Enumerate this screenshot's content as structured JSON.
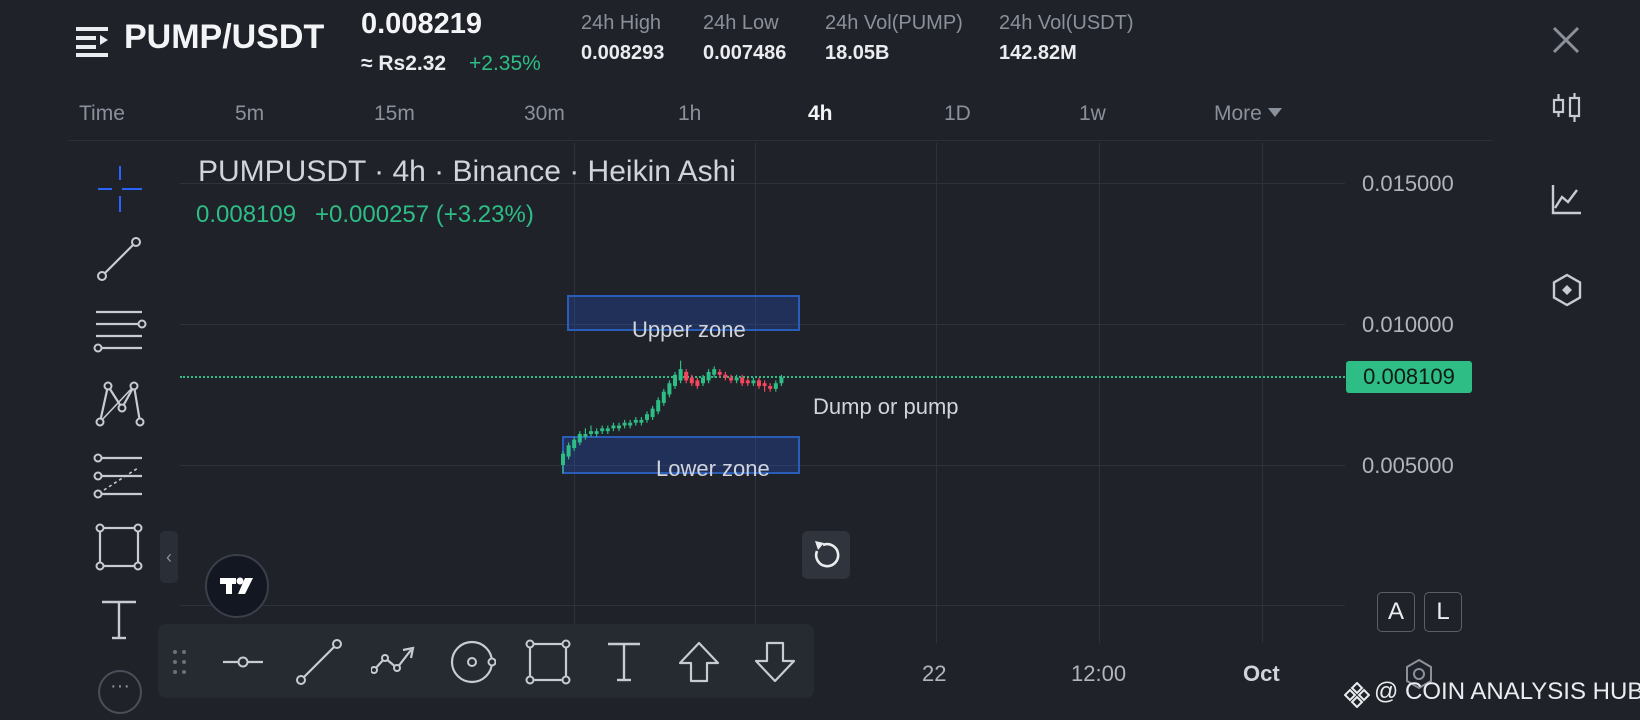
{
  "header": {
    "pair": "PUMP/USDT",
    "last_price": "0.008219",
    "fiat_price": "≈ Rs2.32",
    "change_pct": "+2.35%",
    "stats": [
      {
        "label": "24h High",
        "value": "0.008293"
      },
      {
        "label": "24h Low",
        "value": "0.007486"
      },
      {
        "label": "24h Vol(PUMP)",
        "value": "18.05B"
      },
      {
        "label": "24h Vol(USDT)",
        "value": "142.82M"
      }
    ]
  },
  "tabs": {
    "items": [
      "Time",
      "5m",
      "15m",
      "30m",
      "1h",
      "4h",
      "1D",
      "1w",
      "More"
    ],
    "active": "4h"
  },
  "chart": {
    "title": "PUMPUSDT · 4h · Binance · Heikin Ashi",
    "last": "0.008109",
    "change": "+0.000257 (+3.23%)",
    "price_ticks": [
      "0.015000",
      "0.010000",
      "0.005000"
    ],
    "last_price_tag": "0.008109",
    "x_labels": [
      "22",
      "12:00",
      "Oct"
    ],
    "annotations": {
      "upper_zone": "Upper zone",
      "lower_zone": "Lower zone",
      "note": "Dump or pump"
    }
  },
  "chart_data": {
    "type": "candlestick",
    "title": "PUMPUSDT · 4h · Binance · Heikin Ashi",
    "y_ticks": [
      0.015,
      0.01,
      0.005
    ],
    "ylim": [
      0.0,
      0.0165
    ],
    "x_ticks": [
      "22",
      "12:00",
      "Oct"
    ],
    "last_price": 0.008109,
    "zones": [
      {
        "label": "Upper zone",
        "low": 0.0099,
        "high": 0.011
      },
      {
        "label": "Lower zone",
        "low": 0.0049,
        "high": 0.0061
      }
    ],
    "candles": [
      [
        0.005,
        0.0054,
        0.0047,
        0.0055
      ],
      [
        0.0053,
        0.0057,
        0.0052,
        0.0058
      ],
      [
        0.0056,
        0.0059,
        0.0055,
        0.006
      ],
      [
        0.0058,
        0.0061,
        0.0057,
        0.0062
      ],
      [
        0.006,
        0.0061,
        0.0059,
        0.0063
      ],
      [
        0.0061,
        0.0062,
        0.006,
        0.0064
      ],
      [
        0.0061,
        0.0062,
        0.006,
        0.0063
      ],
      [
        0.0062,
        0.0063,
        0.0061,
        0.0064
      ],
      [
        0.0062,
        0.0063,
        0.0061,
        0.0064
      ],
      [
        0.0063,
        0.0064,
        0.0062,
        0.0065
      ],
      [
        0.0063,
        0.0064,
        0.0062,
        0.0065
      ],
      [
        0.0064,
        0.0065,
        0.0063,
        0.0066
      ],
      [
        0.0064,
        0.0065,
        0.0063,
        0.0066
      ],
      [
        0.0065,
        0.0066,
        0.0064,
        0.0067
      ],
      [
        0.0065,
        0.0066,
        0.0064,
        0.0067
      ],
      [
        0.0066,
        0.0068,
        0.0065,
        0.0069
      ],
      [
        0.0067,
        0.007,
        0.0066,
        0.0071
      ],
      [
        0.0069,
        0.0073,
        0.0068,
        0.0074
      ],
      [
        0.0072,
        0.0076,
        0.0071,
        0.0077
      ],
      [
        0.0075,
        0.0079,
        0.0074,
        0.008
      ],
      [
        0.0078,
        0.0082,
        0.0077,
        0.0083
      ],
      [
        0.008,
        0.0084,
        0.0079,
        0.0087
      ],
      [
        0.0083,
        0.008,
        0.0079,
        0.0084
      ],
      [
        0.0081,
        0.0079,
        0.0078,
        0.0082
      ],
      [
        0.008,
        0.0078,
        0.0077,
        0.0081
      ],
      [
        0.0079,
        0.0081,
        0.0078,
        0.0082
      ],
      [
        0.008,
        0.0083,
        0.0079,
        0.0084
      ],
      [
        0.0082,
        0.0084,
        0.0081,
        0.0085
      ],
      [
        0.0083,
        0.0082,
        0.0081,
        0.0084
      ],
      [
        0.0082,
        0.0081,
        0.008,
        0.0083
      ],
      [
        0.0081,
        0.008,
        0.0079,
        0.0082
      ],
      [
        0.008,
        0.0081,
        0.0079,
        0.0082
      ],
      [
        0.0081,
        0.0079,
        0.0078,
        0.0082
      ],
      [
        0.008,
        0.0079,
        0.0078,
        0.0081
      ],
      [
        0.0079,
        0.008,
        0.0078,
        0.0081
      ],
      [
        0.008,
        0.0078,
        0.0077,
        0.0081
      ],
      [
        0.0079,
        0.0078,
        0.0076,
        0.008
      ],
      [
        0.0078,
        0.0077,
        0.0076,
        0.0079
      ],
      [
        0.0077,
        0.0079,
        0.0076,
        0.008
      ],
      [
        0.0079,
        0.0081,
        0.0078,
        0.0082
      ]
    ],
    "candle_fields": [
      "open",
      "close",
      "low",
      "high"
    ],
    "colors": {
      "up": "#2ebd85",
      "down": "#f6465d",
      "zone": "#2962ff"
    }
  },
  "side_labels": {
    "auto": "A",
    "log": "L"
  },
  "watermark": "@ COIN ANALYSIS HUB"
}
